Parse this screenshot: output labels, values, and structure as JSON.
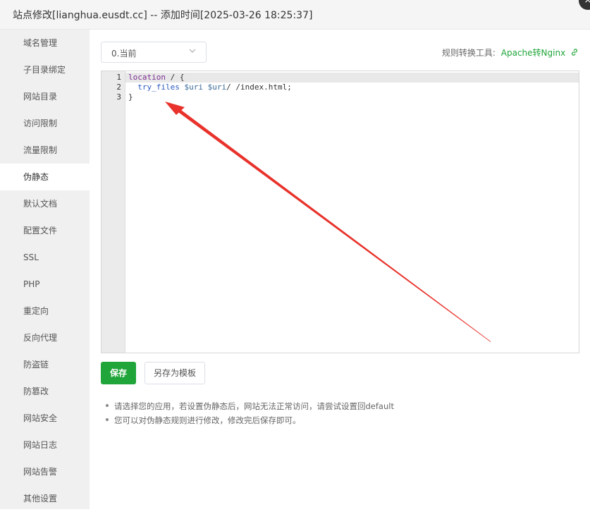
{
  "window": {
    "title": "站点修改[lianghua.eusdt.cc] -- 添加时间[2025-03-26 18:25:37]",
    "close_glyph": "×"
  },
  "sidebar": {
    "items": [
      {
        "label": "域名管理"
      },
      {
        "label": "子目录绑定"
      },
      {
        "label": "网站目录"
      },
      {
        "label": "访问限制"
      },
      {
        "label": "流量限制"
      },
      {
        "label": "伪静态",
        "active": true
      },
      {
        "label": "默认文档"
      },
      {
        "label": "配置文件"
      },
      {
        "label": "SSL"
      },
      {
        "label": "PHP"
      },
      {
        "label": "重定向"
      },
      {
        "label": "反向代理"
      },
      {
        "label": "防盗链"
      },
      {
        "label": "防篡改"
      },
      {
        "label": "网站安全"
      },
      {
        "label": "网站日志"
      },
      {
        "label": "网站告警"
      },
      {
        "label": "其他设置"
      }
    ]
  },
  "rewrite": {
    "template_select": {
      "value": "0.当前"
    },
    "tool_label": "规则转换工具:",
    "tool_link": "Apache转Nginx",
    "editor": {
      "line_numbers": [
        "1",
        "2",
        "3"
      ],
      "lines": {
        "l1_keyword": "location",
        "l1_rest": " / {",
        "l2_indent": "  ",
        "l2_directive": "try_files",
        "l2_sp1": " ",
        "l2_var1": "$uri",
        "l2_sp2": " ",
        "l2_var2": "$uri",
        "l2_rest": "/ /index.html;",
        "l3": "}"
      }
    },
    "save_button": "保存",
    "save_as_template_button": "另存为模板",
    "tips": [
      "请选择您的应用，若设置伪静态后，网站无法正常访问，请尝试设置回default",
      "您可以对伪静态规则进行修改，修改完后保存即可。"
    ]
  },
  "colors": {
    "accent": "#20a53a",
    "annotation_arrow": "#e8322b"
  }
}
